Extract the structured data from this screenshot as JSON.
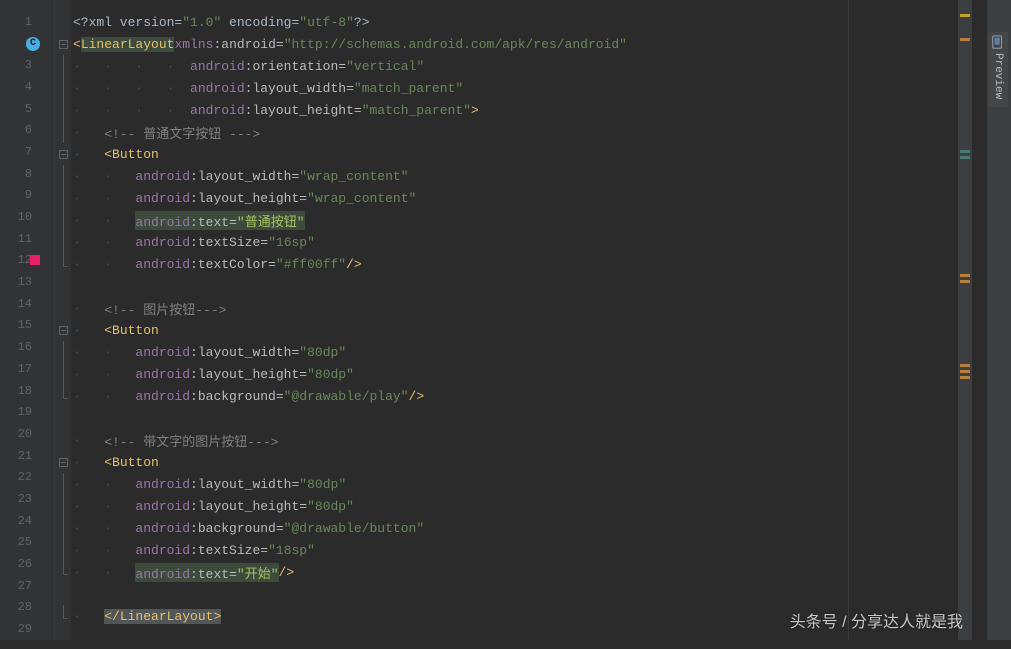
{
  "lines": {
    "count": 29
  },
  "code": {
    "xml_version": "1.0",
    "xml_encoding": "utf-8",
    "root_tag": "LinearLayout",
    "xmlns_ns": "android",
    "xmlns_val": "http://schemas.android.com/apk/res/android",
    "orientation": "vertical",
    "match_parent": "match_parent",
    "comment1": "普通文字按钮",
    "button_tag": "Button",
    "wrap_content": "wrap_content",
    "text1": "普通按钮",
    "textSize1": "16sp",
    "textColor1": "#ff00ff",
    "comment2": "图片按钮",
    "dp80": "80dp",
    "drawable_play": "@drawable/play",
    "comment3": "带文字的图片按钮",
    "drawable_button": "@drawable/button",
    "textSize2": "18sp",
    "text2": "开始",
    "close_root": "LinearLayout",
    "ns": "android",
    "attr_layout_width": "layout_width",
    "attr_layout_height": "layout_height",
    "attr_orientation": "orientation",
    "attr_text": "text",
    "attr_textSize": "textSize",
    "attr_textColor": "textColor",
    "attr_background": "background",
    "attr_xmlns": "xmlns"
  },
  "preview_label": "Preview",
  "watermark": "头条号 / 分享达人就是我"
}
